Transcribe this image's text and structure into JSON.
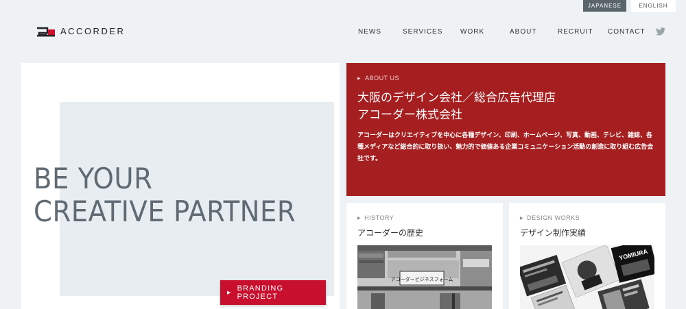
{
  "lang": {
    "japanese": "JAPANESE",
    "english": "ENGLISH"
  },
  "brand": {
    "name": "ACCORDER"
  },
  "nav": [
    "NEWS",
    "SERVICES",
    "WORK",
    "ABOUT",
    "RECRUIT",
    "CONTACT"
  ],
  "hero": {
    "line1": "BE YOUR",
    "line2": "CREATIVE PARTNER",
    "cta": "BRANDING PROJECT"
  },
  "about": {
    "kicker": "ABOUT US",
    "title_line1": "大阪のデザイン会社／総合広告代理店",
    "title_line2": "アコーダー株式会社",
    "body": "アコーダーはクリエイティブを中心に各種デザイン、印刷、ホームページ、写真、動画、テレビ、雑誌、各種メディアなど総合的に取り扱い、魅力的で価値ある企業コミュニケーション活動の創造に取り組む広告会社です。"
  },
  "history": {
    "kicker": "HISTORY",
    "title": "アコーダーの歴史",
    "sign": "アコーダービジネスフォーム"
  },
  "works": {
    "kicker": "DESIGN WORKS",
    "title": "デザイン制作実績",
    "poster_text": "YOMIURA"
  },
  "colors": {
    "accent_red": "#a51e20",
    "cta_red": "#c8102e",
    "bg": "#eef2f4"
  }
}
